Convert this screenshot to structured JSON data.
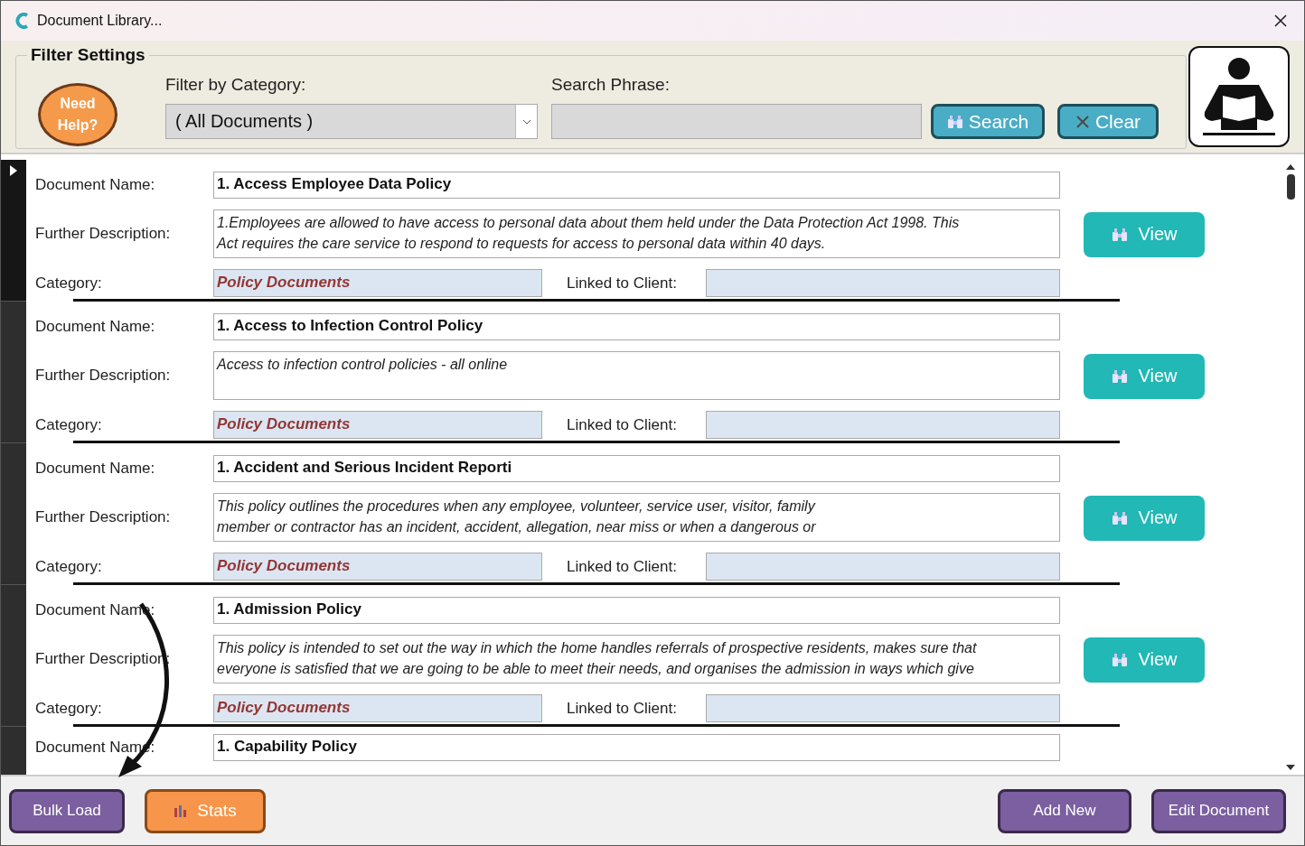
{
  "window": {
    "title": "Document Library..."
  },
  "filter_settings": {
    "title": "Filter Settings",
    "help_button": "Need Help?",
    "category_label": "Filter by Category:",
    "category_value": "( All Documents )",
    "search_label": "Search Phrase:",
    "search_button": "Search",
    "clear_button": "Clear"
  },
  "records": [
    {
      "current": true,
      "name_label": "Document Name:",
      "name": "1. Access Employee Data Policy",
      "description_label": "Further Description:",
      "description_lines": [
        "1.Employees are allowed to have access to personal data about them held under the Data Protection Act 1998. This",
        "Act requires the care service to respond to requests for access to personal data within 40 days."
      ],
      "category_label": "Category:",
      "category": "Policy Documents",
      "client_label": "Linked to Client:",
      "view_button": "View"
    },
    {
      "current": false,
      "name_label": "Document Name:",
      "name": "1. Access to Infection Control Policy",
      "description_label": "Further Description:",
      "description_lines": [
        "Access to infection control policies - all online"
      ],
      "category_label": "Category:",
      "category": "Policy Documents",
      "client_label": "Linked to Client:",
      "view_button": "View"
    },
    {
      "current": false,
      "name_label": "Document Name:",
      "name": "1. Accident and Serious Incident Reporti",
      "description_label": "Further Description:",
      "description_lines": [
        "This policy outlines the procedures when any employee, volunteer, service user, visitor, family",
        "member or contractor has an incident, accident, allegation, near miss or when a dangerous or"
      ],
      "category_label": "Category:",
      "category": "Policy Documents",
      "client_label": "Linked to Client:",
      "view_button": "View"
    },
    {
      "current": false,
      "name_label": "Document Name:",
      "name": "1. Admission Policy",
      "description_label": "Further Description:",
      "description_lines": [
        "This policy is intended to set out the way in which the home handles referrals of prospective residents, makes sure that",
        "everyone is satisfied that we are going to be able to meet their needs, and organises the admission in ways which give"
      ],
      "category_label": "Category:",
      "category": "Policy Documents",
      "client_label": "Linked to Client:",
      "view_button": "View"
    },
    {
      "current": false,
      "name_label": "Document Name:",
      "name": "1. Capability Policy"
    }
  ],
  "footer": {
    "bulk_load_button": "Bulk Load",
    "stats_button": "Stats",
    "add_new_button": "Add New",
    "edit_button": "Edit Document"
  }
}
